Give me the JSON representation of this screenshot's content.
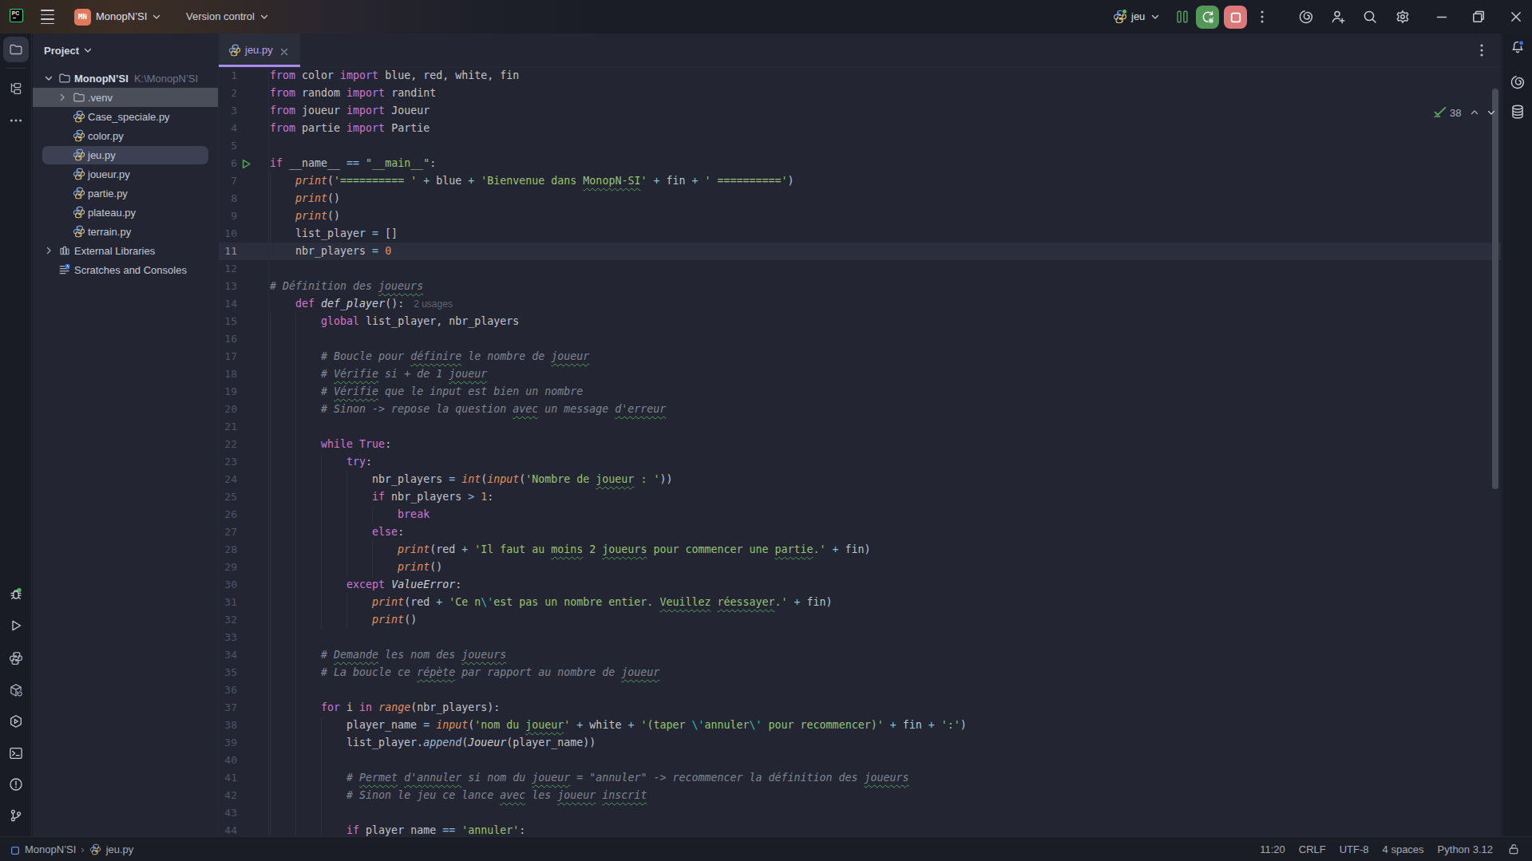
{
  "colors": {
    "accent_purple": "#a78bea",
    "run_green": "#549857",
    "stop_red": "#dd7878",
    "pycharm_green": "#20d789",
    "project_chip": "#e2795b",
    "squiggle_green": "#4e9e58",
    "notification_blue": "#3574f0"
  },
  "titlebar": {
    "app_icon": "pycharm-logo",
    "app_icon_text": "PC",
    "menu_icon": "burger-icon",
    "project_chip_text": "MN",
    "project_name": "MonopN’SI",
    "version_control_label": "Version control",
    "run_config_name": "jeu",
    "buttons": [
      "pause",
      "rerun",
      "stop",
      "more",
      "ai",
      "add-user",
      "search",
      "settings",
      "minimize",
      "maximize",
      "close"
    ]
  },
  "left_stripe": {
    "top_items": [
      {
        "icon": "folder-icon",
        "name": "project",
        "selected": true
      },
      {
        "icon": "structure-icon",
        "name": "structure",
        "selected": false
      },
      {
        "icon": "more-icon",
        "name": "more",
        "selected": false
      }
    ],
    "bottom_items": [
      {
        "icon": "debug-icon",
        "name": "debug",
        "green_dot": true
      },
      {
        "icon": "play-icon",
        "name": "run"
      },
      {
        "icon": "python-console-icon",
        "name": "python-console"
      },
      {
        "icon": "packages-icon",
        "name": "python-packages"
      },
      {
        "icon": "services-icon",
        "name": "services"
      },
      {
        "icon": "terminal-icon",
        "name": "terminal"
      },
      {
        "icon": "problems-icon",
        "name": "problems"
      },
      {
        "icon": "git-icon",
        "name": "version-control"
      }
    ]
  },
  "project_panel": {
    "header": "Project",
    "tree": [
      {
        "depth": 0,
        "chevron": "down",
        "icon": "folder-icon",
        "label": "MonopN’SI",
        "path": "K:\\MonopN’SI",
        "bold": true
      },
      {
        "depth": 1,
        "chevron": "right",
        "icon": "folder-icon",
        "label": ".venv",
        "state": "hover"
      },
      {
        "depth": 1,
        "icon": "python-icon",
        "label": "Case_speciale.py"
      },
      {
        "depth": 1,
        "icon": "python-icon",
        "label": "color.py"
      },
      {
        "depth": 1,
        "icon": "python-icon",
        "label": "jeu.py",
        "state": "selected"
      },
      {
        "depth": 1,
        "icon": "python-icon",
        "label": "joueur.py"
      },
      {
        "depth": 1,
        "icon": "python-icon",
        "label": "partie.py"
      },
      {
        "depth": 1,
        "icon": "python-icon",
        "label": "plateau.py"
      },
      {
        "depth": 1,
        "icon": "python-icon",
        "label": "terrain.py"
      },
      {
        "depth": 0,
        "chevron": "right",
        "icon": "library-icon",
        "label": "External Libraries"
      },
      {
        "depth": 0,
        "icon": "scratches-icon",
        "label": "Scratches and Consoles"
      }
    ]
  },
  "tabbar": {
    "tabs": [
      {
        "icon": "python-icon",
        "label": "jeu.py",
        "active": true,
        "close_icon": "close-icon"
      }
    ]
  },
  "editor": {
    "run_gutter_line": 6,
    "current_line": 11,
    "inspection": {
      "icon": "typo-check-icon",
      "count": "38",
      "up": "chevron-up-icon",
      "down": "chevron-down-icon"
    },
    "lines": [
      [
        [
          "k",
          "from"
        ],
        [
          "d",
          " color "
        ],
        [
          "k",
          "import"
        ],
        [
          "d",
          " blue, red, white, fin"
        ]
      ],
      [
        [
          "k",
          "from"
        ],
        [
          "d",
          " random "
        ],
        [
          "k",
          "import"
        ],
        [
          "d",
          " randint"
        ]
      ],
      [
        [
          "k",
          "from"
        ],
        [
          "d",
          " joueur "
        ],
        [
          "k",
          "import"
        ],
        [
          "d",
          " Joueur"
        ]
      ],
      [
        [
          "k",
          "from"
        ],
        [
          "d",
          " partie "
        ],
        [
          "k",
          "import"
        ],
        [
          "d",
          " Partie"
        ]
      ],
      [],
      [
        [
          "k",
          "if"
        ],
        [
          "d",
          " __name__ "
        ],
        [
          "o",
          "=="
        ],
        [
          "d",
          " "
        ],
        [
          "s",
          "\"__main__\""
        ],
        [
          "d",
          ":"
        ]
      ],
      [
        [
          "d",
          "    "
        ],
        [
          "b",
          "print"
        ],
        [
          "d",
          "("
        ],
        [
          "s",
          "'========== '"
        ],
        [
          "d",
          " "
        ],
        [
          "o",
          "+"
        ],
        [
          "d",
          " blue "
        ],
        [
          "o",
          "+"
        ],
        [
          "d",
          " "
        ],
        [
          "s",
          "'Bienvenue dans "
        ],
        [
          "s q",
          "MonopN-SI"
        ],
        [
          "s",
          "'"
        ],
        [
          "d",
          " "
        ],
        [
          "o",
          "+"
        ],
        [
          "d",
          " fin "
        ],
        [
          "o",
          "+"
        ],
        [
          "d",
          " "
        ],
        [
          "s",
          "' =========='"
        ],
        [
          "d",
          ")"
        ]
      ],
      [
        [
          "d",
          "    "
        ],
        [
          "b",
          "print"
        ],
        [
          "d",
          "()"
        ]
      ],
      [
        [
          "d",
          "    "
        ],
        [
          "b",
          "print"
        ],
        [
          "d",
          "()"
        ]
      ],
      [
        [
          "d",
          "    list_player "
        ],
        [
          "o",
          "="
        ],
        [
          "d",
          " []"
        ]
      ],
      [
        [
          "d",
          "    nbr_players "
        ],
        [
          "o",
          "="
        ],
        [
          "d",
          " "
        ],
        [
          "n",
          "0"
        ]
      ],
      [],
      [
        [
          "c",
          "# Définition des "
        ],
        [
          "c q",
          "joueurs"
        ]
      ],
      [
        [
          "d",
          "    "
        ],
        [
          "k",
          "def"
        ],
        [
          "d",
          " "
        ],
        [
          "f",
          "def_player"
        ],
        [
          "d",
          "():"
        ],
        [
          "u",
          "2 usages"
        ]
      ],
      [
        [
          "d",
          "        "
        ],
        [
          "k",
          "global"
        ],
        [
          "d",
          " list_player, nbr_players"
        ]
      ],
      [],
      [
        [
          "d",
          "        "
        ],
        [
          "c",
          "# Boucle pour "
        ],
        [
          "c q",
          "définire"
        ],
        [
          "c",
          " le nombre de "
        ],
        [
          "c q",
          "joueur"
        ]
      ],
      [
        [
          "d",
          "        "
        ],
        [
          "c",
          "# "
        ],
        [
          "c q",
          "Vérifie"
        ],
        [
          "c",
          " si + de 1 "
        ],
        [
          "c q",
          "joueur"
        ]
      ],
      [
        [
          "d",
          "        "
        ],
        [
          "c",
          "# "
        ],
        [
          "c q",
          "Vérifie"
        ],
        [
          "c",
          " que le input est bien un nombre"
        ]
      ],
      [
        [
          "d",
          "        "
        ],
        [
          "c",
          "# Sinon -> repose la question "
        ],
        [
          "c q",
          "avec"
        ],
        [
          "c",
          " un message "
        ],
        [
          "c q",
          "d'erreur"
        ]
      ],
      [],
      [
        [
          "d",
          "        "
        ],
        [
          "k",
          "while"
        ],
        [
          "d",
          " "
        ],
        [
          "k",
          "True"
        ],
        [
          "d",
          ":"
        ]
      ],
      [
        [
          "d",
          "            "
        ],
        [
          "k",
          "try"
        ],
        [
          "d",
          ":"
        ]
      ],
      [
        [
          "d",
          "                nbr_players "
        ],
        [
          "o",
          "="
        ],
        [
          "d",
          " "
        ],
        [
          "b",
          "int"
        ],
        [
          "d",
          "("
        ],
        [
          "b",
          "input"
        ],
        [
          "d",
          "("
        ],
        [
          "s",
          "'Nombre de "
        ],
        [
          "s q",
          "joueur"
        ],
        [
          "s",
          " : '"
        ],
        [
          "d",
          "))"
        ]
      ],
      [
        [
          "d",
          "                "
        ],
        [
          "k",
          "if"
        ],
        [
          "d",
          " nbr_players "
        ],
        [
          "o",
          ">"
        ],
        [
          "d",
          " "
        ],
        [
          "n",
          "1"
        ],
        [
          "d",
          ":"
        ]
      ],
      [
        [
          "d",
          "                    "
        ],
        [
          "k",
          "break"
        ]
      ],
      [
        [
          "d",
          "                "
        ],
        [
          "k",
          "else"
        ],
        [
          "d",
          ":"
        ]
      ],
      [
        [
          "d",
          "                    "
        ],
        [
          "b",
          "print"
        ],
        [
          "d",
          "(red "
        ],
        [
          "o",
          "+"
        ],
        [
          "d",
          " "
        ],
        [
          "s",
          "'Il faut au "
        ],
        [
          "s q",
          "moins"
        ],
        [
          "s",
          " 2 "
        ],
        [
          "s q",
          "joueurs"
        ],
        [
          "s",
          " pour commencer une "
        ],
        [
          "s q",
          "partie"
        ],
        [
          "s",
          ".'"
        ],
        [
          "d",
          " "
        ],
        [
          "o",
          "+"
        ],
        [
          "d",
          " fin)"
        ]
      ],
      [
        [
          "d",
          "                    "
        ],
        [
          "b",
          "print"
        ],
        [
          "d",
          "()"
        ]
      ],
      [
        [
          "d",
          "            "
        ],
        [
          "k",
          "except"
        ],
        [
          "d",
          " "
        ],
        [
          "t",
          "ValueError"
        ],
        [
          "d",
          ":"
        ]
      ],
      [
        [
          "d",
          "                "
        ],
        [
          "b",
          "print"
        ],
        [
          "d",
          "(red "
        ],
        [
          "o",
          "+"
        ],
        [
          "d",
          " "
        ],
        [
          "s",
          "'Ce n"
        ],
        [
          "e",
          "\\'"
        ],
        [
          "s",
          "est pas un nombre entier. "
        ],
        [
          "s q",
          "Veuillez"
        ],
        [
          "s",
          " "
        ],
        [
          "s q",
          "réessayer"
        ],
        [
          "s",
          ".'"
        ],
        [
          "d",
          " "
        ],
        [
          "o",
          "+"
        ],
        [
          "d",
          " fin)"
        ]
      ],
      [
        [
          "d",
          "                "
        ],
        [
          "b",
          "print"
        ],
        [
          "d",
          "()"
        ]
      ],
      [],
      [
        [
          "d",
          "        "
        ],
        [
          "c",
          "# "
        ],
        [
          "c q",
          "Demande"
        ],
        [
          "c",
          " les nom des "
        ],
        [
          "c q",
          "joueurs"
        ]
      ],
      [
        [
          "d",
          "        "
        ],
        [
          "c",
          "# La boucle ce "
        ],
        [
          "c q",
          "répète"
        ],
        [
          "c",
          " par rapport au nombre de "
        ],
        [
          "c q",
          "joueur"
        ]
      ],
      [],
      [
        [
          "d",
          "        "
        ],
        [
          "k",
          "for"
        ],
        [
          "d",
          " i "
        ],
        [
          "k",
          "in"
        ],
        [
          "d",
          " "
        ],
        [
          "b",
          "range"
        ],
        [
          "d",
          "(nbr_players):"
        ]
      ],
      [
        [
          "d",
          "            player_name "
        ],
        [
          "o",
          "="
        ],
        [
          "d",
          " "
        ],
        [
          "b",
          "input"
        ],
        [
          "d",
          "("
        ],
        [
          "s",
          "'nom du "
        ],
        [
          "s q",
          "joueur"
        ],
        [
          "s",
          "'"
        ],
        [
          "d",
          " "
        ],
        [
          "o",
          "+"
        ],
        [
          "d",
          " white "
        ],
        [
          "o",
          "+"
        ],
        [
          "d",
          " "
        ],
        [
          "s",
          "'(taper "
        ],
        [
          "e",
          "\\'"
        ],
        [
          "s",
          "annuler"
        ],
        [
          "e",
          "\\'"
        ],
        [
          "s",
          " pour recommencer)'"
        ],
        [
          "d",
          " "
        ],
        [
          "o",
          "+"
        ],
        [
          "d",
          " fin "
        ],
        [
          "o",
          "+"
        ],
        [
          "d",
          " "
        ],
        [
          "s",
          "':'"
        ],
        [
          "d",
          ")"
        ]
      ],
      [
        [
          "d",
          "            list_player."
        ],
        [
          "m",
          "append"
        ],
        [
          "d",
          "("
        ],
        [
          "t",
          "Joueur"
        ],
        [
          "d",
          "(player_name))"
        ]
      ],
      [],
      [
        [
          "d",
          "            "
        ],
        [
          "c",
          "# "
        ],
        [
          "c q",
          "Permet"
        ],
        [
          "c",
          " "
        ],
        [
          "c q",
          "d'annuler"
        ],
        [
          "c",
          " si nom du "
        ],
        [
          "c q",
          "joueur"
        ],
        [
          "c",
          " = \"annuler\" -> recommencer la définition des "
        ],
        [
          "c q",
          "joueurs"
        ]
      ],
      [
        [
          "d",
          "            "
        ],
        [
          "c",
          "# Sinon le jeu ce lance "
        ],
        [
          "c q",
          "avec"
        ],
        [
          "c",
          " les "
        ],
        [
          "c q",
          "joueur"
        ],
        [
          "c",
          " "
        ],
        [
          "c q",
          "inscrit"
        ]
      ],
      [],
      [
        [
          "d",
          "            "
        ],
        [
          "k",
          "if"
        ],
        [
          "d",
          " player_name "
        ],
        [
          "o",
          "=="
        ],
        [
          "d",
          " "
        ],
        [
          "s",
          "'annuler'"
        ],
        [
          "d",
          ":"
        ]
      ]
    ],
    "indent_guides": [
      {
        "col": 0,
        "from": 7,
        "to": 11
      },
      {
        "col": 0,
        "from": 15,
        "to": 44
      },
      {
        "col": 1,
        "from": 15,
        "to": 44
      },
      {
        "col": 2,
        "from": 23,
        "to": 32
      },
      {
        "col": 2,
        "from": 38,
        "to": 44
      },
      {
        "col": 3,
        "from": 24,
        "to": 29
      },
      {
        "col": 3,
        "from": 31,
        "to": 32
      },
      {
        "col": 4,
        "from": 26,
        "to": 26
      },
      {
        "col": 4,
        "from": 28,
        "to": 29
      }
    ]
  },
  "right_stripe": {
    "items": [
      {
        "icon": "bell-icon",
        "name": "notifications",
        "blue_dot": true
      },
      {
        "icon": "ai-icon",
        "name": "ai-assistant"
      },
      {
        "icon": "database-icon",
        "name": "database"
      }
    ]
  },
  "statusbar": {
    "breadcrumbs": [
      {
        "icon": "project-square-icon",
        "label": "MonopN’SI"
      },
      {
        "icon": "python-icon",
        "label": "jeu.py"
      }
    ],
    "separator": "›",
    "items": [
      "11:20",
      "CRLF",
      "UTF-8",
      "4 spaces",
      "Python 3.12"
    ],
    "lock_icon": "unlock-icon"
  }
}
